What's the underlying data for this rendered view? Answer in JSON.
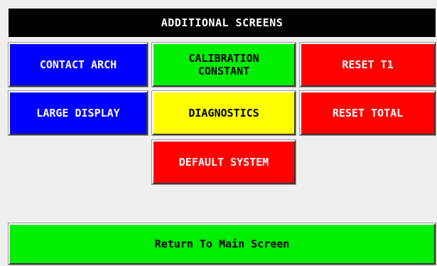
{
  "header": {
    "title": "ADDITIONAL SCREENS"
  },
  "buttons": {
    "contact_arch": "CONTACT ARCH",
    "calibration_constant": "CALIBRATION\nCONSTANT",
    "reset_t1": "RESET T1",
    "large_display": "LARGE DISPLAY",
    "diagnostics": "DIAGNOSTICS",
    "reset_total": "RESET TOTAL",
    "default_system": "DEFAULT SYSTEM",
    "return_main": "Return To Main Screen"
  },
  "colors": {
    "header_bg": "#000000",
    "blue": "#0000ff",
    "green": "#00ee00",
    "red": "#ff0000",
    "yellow": "#ffff00",
    "background": "#efefef"
  }
}
